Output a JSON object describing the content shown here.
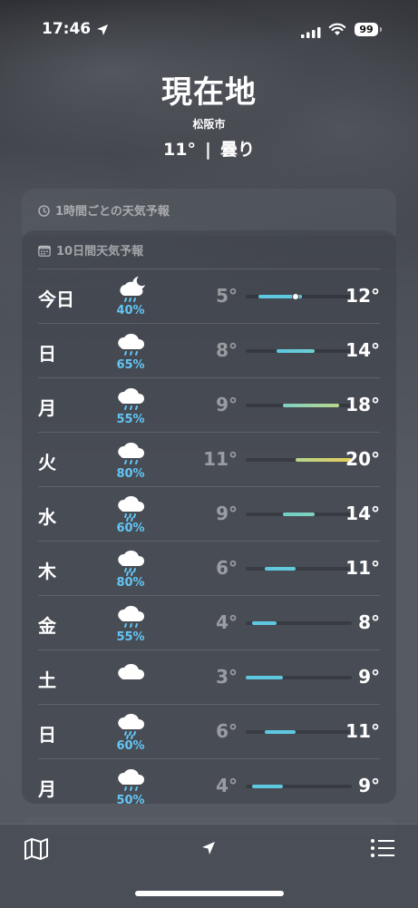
{
  "status": {
    "time": "17:46",
    "battery": "99",
    "icons": [
      "location-arrow-icon",
      "cellular-signal-icon",
      "wifi-icon",
      "battery-icon"
    ]
  },
  "header": {
    "location": "現在地",
    "sublocation": "松阪市",
    "temperature": "11°",
    "separator": "|",
    "condition": "曇り"
  },
  "hourly_card": {
    "label": "1時間ごとの天気予報",
    "icon": "clock-icon"
  },
  "daily_card": {
    "label": "10日間天気予報",
    "icon": "calendar-icon",
    "range_min": 3,
    "range_max": 20,
    "current_temp": 11,
    "days": [
      {
        "day": "今日",
        "icon": "partly-cloudy-night-rain-icon",
        "precip": "40%",
        "low": "5°",
        "high": "12°",
        "lo": 5,
        "hi": 12,
        "colors": [
          "#5ec8e0",
          "#5ec8e0"
        ],
        "now": true
      },
      {
        "day": "日",
        "icon": "cloud-rain-icon",
        "precip": "65%",
        "low": "8°",
        "high": "14°",
        "lo": 8,
        "hi": 14,
        "colors": [
          "#5ec8e0",
          "#6ccfce"
        ]
      },
      {
        "day": "月",
        "icon": "cloud-rain-icon",
        "precip": "55%",
        "low": "9°",
        "high": "18°",
        "lo": 9,
        "hi": 18,
        "colors": [
          "#7fd0c4",
          "#b8d88a"
        ]
      },
      {
        "day": "火",
        "icon": "cloud-rain-icon",
        "precip": "80%",
        "low": "11°",
        "high": "20°",
        "lo": 11,
        "hi": 20,
        "colors": [
          "#b5d58a",
          "#e6cf5a"
        ]
      },
      {
        "day": "水",
        "icon": "cloud-heavy-rain-icon",
        "precip": "60%",
        "low": "9°",
        "high": "14°",
        "lo": 9,
        "hi": 14,
        "colors": [
          "#6fcfc6",
          "#80d2bb"
        ]
      },
      {
        "day": "木",
        "icon": "cloud-heavy-rain-icon",
        "precip": "80%",
        "low": "6°",
        "high": "11°",
        "lo": 6,
        "hi": 11,
        "colors": [
          "#5ec8e0",
          "#62cadb"
        ]
      },
      {
        "day": "金",
        "icon": "cloud-rain-icon",
        "precip": "55%",
        "low": "4°",
        "high": "8°",
        "lo": 4,
        "hi": 8,
        "colors": [
          "#5ec8e0",
          "#5ec8e0"
        ]
      },
      {
        "day": "土",
        "icon": "cloud-icon",
        "precip": "",
        "low": "3°",
        "high": "9°",
        "lo": 3,
        "hi": 9,
        "colors": [
          "#5ec8e0",
          "#5ec8e0"
        ]
      },
      {
        "day": "日",
        "icon": "cloud-heavy-rain-icon",
        "precip": "60%",
        "low": "6°",
        "high": "11°",
        "lo": 6,
        "hi": 11,
        "colors": [
          "#5ec8e0",
          "#5ec8e0"
        ]
      },
      {
        "day": "月",
        "icon": "cloud-rain-icon",
        "precip": "50%",
        "low": "4°",
        "high": "9°",
        "lo": 4,
        "hi": 9,
        "colors": [
          "#5ec8e0",
          "#5ec8e0"
        ]
      }
    ]
  },
  "toolbar": {
    "left_icon": "map-icon",
    "center_icon": "location-arrow-icon",
    "right_icon": "list-icon"
  }
}
